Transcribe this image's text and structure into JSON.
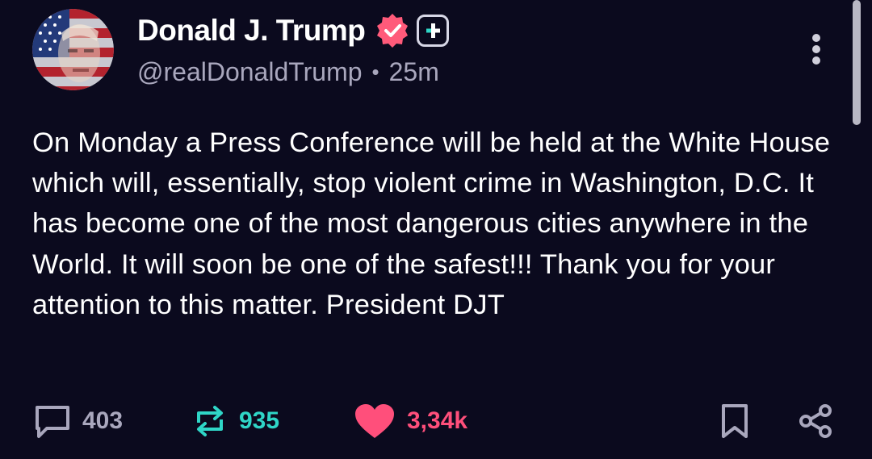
{
  "post": {
    "author": {
      "display_name": "Donald J. Trump",
      "handle": "@realDonaldTrump",
      "time_ago": "25m",
      "separator": "•"
    },
    "text": "On Monday a Press Conference will be held at the White House which will, essentially, stop violent crime in Washington, D.C. It has become one of the most dangerous cities anywhere in the World. It will soon be one of the safest!!! Thank you for your attention to this matter. President DJT",
    "stats": {
      "replies": "403",
      "reposts": "935",
      "likes": "3,34k"
    }
  },
  "icons": {
    "avatar": "avatar-flag-portrait",
    "verified": "verified-badge-icon",
    "plus": "plus-badge-icon",
    "more": "more-vertical-icon",
    "reply": "reply-icon",
    "repost": "repost-icon",
    "like": "heart-icon",
    "bookmark": "bookmark-icon",
    "share": "share-icon"
  },
  "colors": {
    "background": "#0b0a1e",
    "text": "#ffffff",
    "muted": "#a9a7bd",
    "verified": "#ff5a7a",
    "repost": "#2fd6c7",
    "like": "#ff4f7b"
  }
}
